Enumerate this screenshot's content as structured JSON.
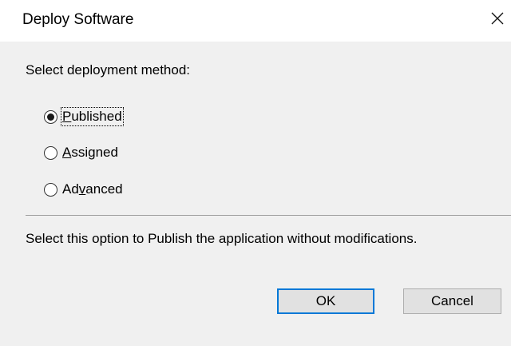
{
  "window": {
    "title": "Deploy Software",
    "close_icon": "close-icon"
  },
  "prompt": "Select deployment method:",
  "options": [
    {
      "before": "",
      "mnemonic": "P",
      "after": "ublished",
      "checked": true
    },
    {
      "before": "",
      "mnemonic": "A",
      "after": "ssigned",
      "checked": false
    },
    {
      "before": "Ad",
      "mnemonic": "v",
      "after": "anced",
      "checked": false
    }
  ],
  "description": "Select this option to Publish the application without modifications.",
  "buttons": {
    "ok": "OK",
    "cancel": "Cancel"
  },
  "colors": {
    "accent": "#0078d7",
    "dialog_background": "#f0f0f0",
    "titlebar_background": "#ffffff"
  }
}
